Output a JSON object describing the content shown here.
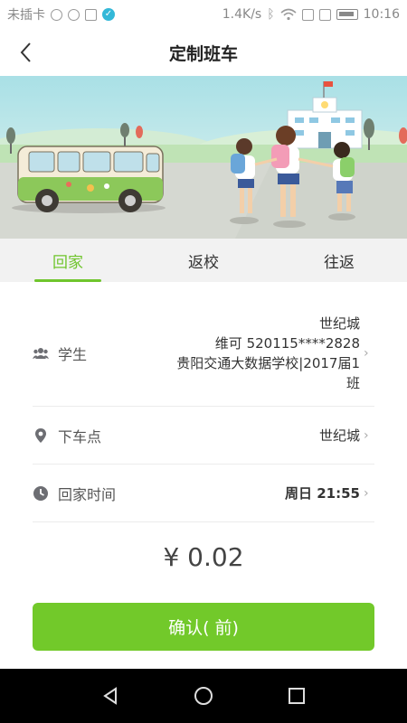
{
  "status_bar": {
    "carrier": "未插卡",
    "speed": "1.4K/s",
    "time": "10:16"
  },
  "header": {
    "title": "定制班车"
  },
  "tabs": [
    {
      "label": "回家",
      "active": true
    },
    {
      "label": "返校",
      "active": false
    },
    {
      "label": "往返",
      "active": false
    }
  ],
  "form": {
    "student": {
      "label": "学生",
      "lines": [
        "世纪城",
        "维可 520115****2828",
        "贵阳交通大数据学校|2017届1",
        "班"
      ]
    },
    "dropoff": {
      "label": "下车点",
      "value": "世纪城"
    },
    "home_time": {
      "label": "回家时间",
      "value": "周日 21:55"
    }
  },
  "price": "¥ 0.02",
  "confirm_label": "确认( 前)",
  "colors": {
    "accent": "#72c92a",
    "tab_active": "#6fc52c"
  }
}
